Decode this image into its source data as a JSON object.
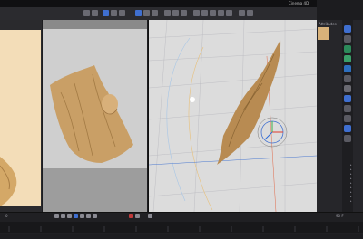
{
  "window": {
    "title": "Cinema 4D"
  },
  "right_panel": {
    "header": "Attributes",
    "rows": [
      "▸",
      "▸",
      "▸",
      "▸",
      "▸",
      "▸",
      "▸",
      "▸",
      "▸",
      "▸",
      "▸",
      "▸"
    ]
  },
  "timeline": {
    "frame": "0",
    "end_frame": "90 F"
  },
  "icons": [
    "move-icon",
    "scale-icon",
    "rotate-icon",
    "select-icon",
    "render-icon",
    "cloth-icon",
    "light-icon",
    "camera-icon",
    "object-icon",
    "deformer-icon",
    "tag-icon",
    "sim-icon",
    "hair-icon",
    "mograph-icon",
    "field-icon",
    "layer-icon",
    "material-icon"
  ],
  "colors": {
    "cloth": "#c8a06a",
    "accent": "#3f6fd0",
    "panel": "#26262a"
  }
}
